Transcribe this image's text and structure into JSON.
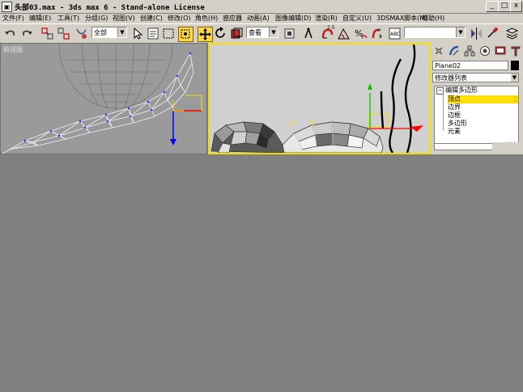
{
  "window": {
    "title": "头部03.max - 3ds max 6 - Stand-alone License",
    "icon": "3dsmax-app-icon",
    "controls": {
      "minimize": "_",
      "maximize": "□",
      "close": "x"
    }
  },
  "menubar": {
    "items": [
      {
        "label": "文件(F)"
      },
      {
        "label": "编辑(E)"
      },
      {
        "label": "工具(T)"
      },
      {
        "label": "分组(G)"
      },
      {
        "label": "视图(V)"
      },
      {
        "label": "创建(C)"
      },
      {
        "label": "修改(O)"
      },
      {
        "label": "角色(H)"
      },
      {
        "label": "感应器"
      },
      {
        "label": "动画(A)"
      },
      {
        "label": "图像编辑(D)"
      },
      {
        "label": "渲染(R)"
      },
      {
        "label": "自定义(U)"
      },
      {
        "label": "3DSMAX脚本(M)"
      },
      {
        "label": "帮助(H)"
      }
    ]
  },
  "toolbar": {
    "selection_filter": "全部",
    "reference_coord": "查看",
    "named_selection": "",
    "snap_angle_label": "2.5",
    "percent_snap_label": "%",
    "icons": [
      "undo-icon",
      "redo-icon",
      "select-link-icon",
      "unlink-icon",
      "bind-space-warp-icon",
      "select-object-icon",
      "select-by-name-icon",
      "rectangle-select-icon",
      "window-crossing-icon",
      "move-icon",
      "rotate-icon",
      "scale-icon",
      "pivot-icon",
      "manipulate-icon",
      "snap-icon",
      "angle-snap-icon",
      "percent-snap-icon",
      "spinner-snap-icon",
      "edit-named-sel-icon",
      "mirror-icon",
      "align-icon",
      "layer-icon"
    ]
  },
  "viewports": {
    "left": {
      "label": "俯视图"
    },
    "right": {
      "label": ""
    }
  },
  "command_panel": {
    "tabs": [
      "create-icon",
      "modify-icon",
      "hierarchy-icon",
      "motion-icon",
      "display-icon",
      "utilities-icon"
    ],
    "object_name": "Plane02",
    "object_color": "#000000",
    "modifier_list_label": "修改器列表",
    "stack": {
      "root": "编辑多边形",
      "subobjects": [
        {
          "label": "顶点",
          "selected": true
        },
        {
          "label": "边界",
          "selected": false
        },
        {
          "label": "边框",
          "selected": false
        },
        {
          "label": "多边形",
          "selected": false
        },
        {
          "label": "元素",
          "selected": false
        }
      ]
    }
  }
}
